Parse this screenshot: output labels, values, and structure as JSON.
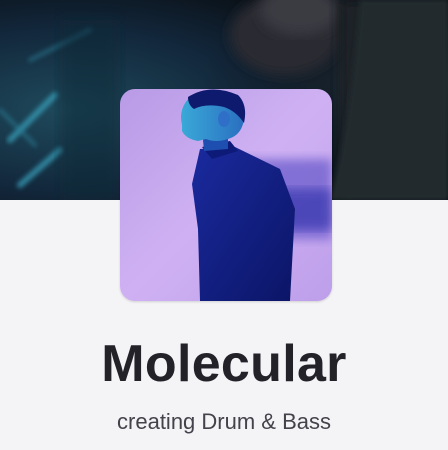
{
  "profile": {
    "name": "Molecular",
    "tagline": "creating Drum & Bass"
  },
  "colors": {
    "page_background": "#f4f3f6",
    "banner_base": "#0e1a22",
    "avatar_background": "#c6a8f0",
    "avatar_figure": "#0f1f8a",
    "name_text": "#232229",
    "tagline_text": "#44434b"
  }
}
